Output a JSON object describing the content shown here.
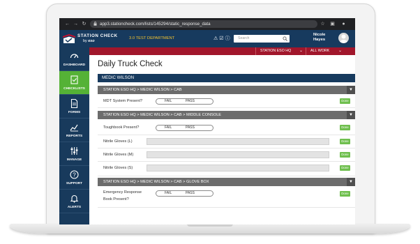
{
  "browser": {
    "url": "app3.stationcheck.com/lists/145294/static_response_data"
  },
  "app": {
    "logo_title": "STATION CHECK",
    "logo_by": "by",
    "logo_brand": "eso",
    "department": "3.0 TEST DEPARTMENT",
    "search_placeholder": "Search",
    "user_first": "Nicole",
    "user_last": "Hayes"
  },
  "sidebar": {
    "items": [
      {
        "label": "DASHBOARD",
        "icon": "gauge-icon"
      },
      {
        "label": "CHECKLISTS",
        "icon": "checklist-icon",
        "active": true
      },
      {
        "label": "FORMS",
        "icon": "document-icon"
      },
      {
        "label": "REPORTS",
        "icon": "chart-icon"
      },
      {
        "label": "MANAGE",
        "icon": "sliders-icon"
      },
      {
        "label": "SUPPORT",
        "icon": "help-icon"
      },
      {
        "label": "ALERTS",
        "icon": "bell-icon"
      }
    ]
  },
  "filters": {
    "station": "STATION ESO HQ",
    "work": "ALL WORK"
  },
  "page": {
    "title": "Daily Truck Check",
    "section": "MEDIC WILSON"
  },
  "groups": [
    {
      "crumb": "STATION ESO HQ > MEDIC WILSON > CAB"
    },
    {
      "crumb": "STATION ESO HQ > MEDIC WILSON > CAB > MIDDLE CONSOLE"
    },
    {
      "crumb": "STATION ESO HQ > MEDIC WILSON > CAB > GLOVE BOX"
    }
  ],
  "rows": [
    {
      "label": "MDT System Present?",
      "fail": "FAIL",
      "pass": "PASS",
      "done": "Done"
    },
    {
      "label": "Toughbook Present?",
      "fail": "FAIL",
      "pass": "PASS",
      "done": "Done"
    },
    {
      "label": "Nitrile Gloves (L)",
      "value": "",
      "done": "Done"
    },
    {
      "label": "Nitrile Gloves (M)",
      "value": "",
      "done": "Done"
    },
    {
      "label": "Nitrile Gloves (S)",
      "value": "",
      "done": "Done"
    },
    {
      "label_line1": "Emergency Response",
      "label_line2": "Book Present?",
      "fail": "FAIL",
      "pass": "PASS",
      "done": "Done"
    }
  ],
  "colors": {
    "navy": "#173a5e",
    "accent_red": "#a1162b",
    "active_green": "#55b236",
    "done_green": "#6fbf4e",
    "dept_yellow": "#f2c230"
  }
}
